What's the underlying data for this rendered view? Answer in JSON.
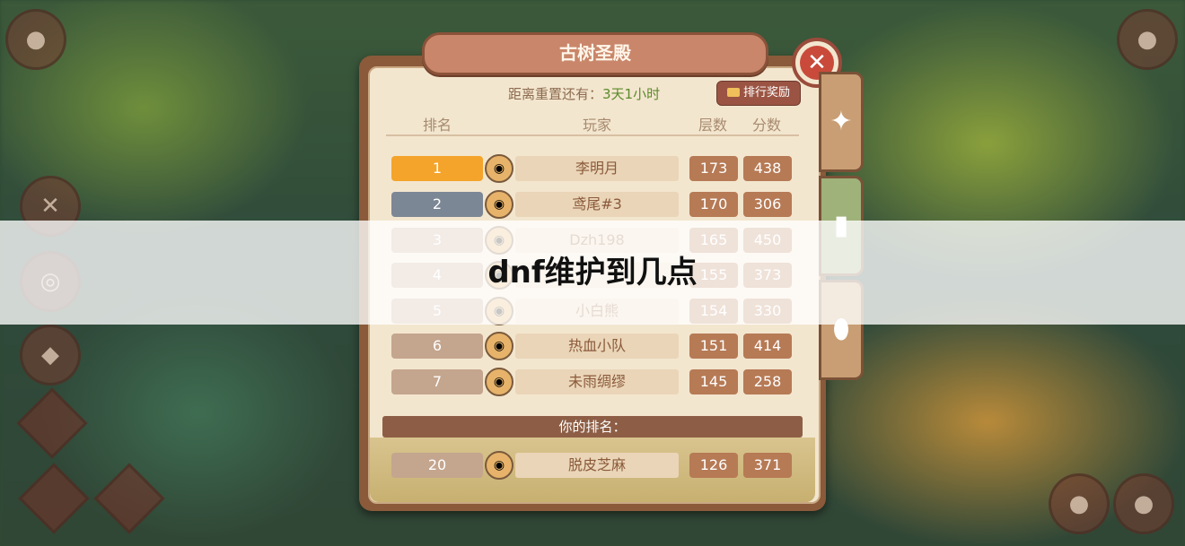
{
  "panel": {
    "title": "古树圣殿",
    "reset_label": "距离重置还有：",
    "reset_value": "3天1小时",
    "reward_button": "排行奖励",
    "headers": {
      "rank": "排名",
      "player": "玩家",
      "floors": "层数",
      "score": "分数"
    },
    "rows": [
      {
        "rank": "1",
        "name": "李明月",
        "floors": "173",
        "score": "438",
        "rank_color": "#f4a42a"
      },
      {
        "rank": "2",
        "name": "鸢尾#3",
        "floors": "170",
        "score": "306",
        "rank_color": "#7c8796"
      },
      {
        "rank": "3",
        "name": "Dzh198",
        "floors": "165",
        "score": "450",
        "rank_color": "#c4a58e"
      },
      {
        "rank": "4",
        "name": "",
        "floors": "155",
        "score": "373",
        "rank_color": "#c4a58e"
      },
      {
        "rank": "5",
        "name": "小白熊",
        "floors": "154",
        "score": "330",
        "rank_color": "#c4a58e"
      },
      {
        "rank": "6",
        "name": "热血小队",
        "floors": "151",
        "score": "414",
        "rank_color": "#c4a58e"
      },
      {
        "rank": "7",
        "name": "未雨绸缪",
        "floors": "145",
        "score": "258",
        "rank_color": "#c4a58e"
      }
    ],
    "your_rank_label": "你的排名：",
    "your_row": {
      "rank": "20",
      "name": "脱皮芝麻",
      "floors": "126",
      "score": "371"
    }
  },
  "overlay": {
    "text": "dnf维护到几点"
  },
  "icons": {
    "close": "close-icon",
    "tab1": "star-cross-icon",
    "tab2": "bars-icon",
    "tab3": "egg-icon",
    "reward": "chest-icon"
  }
}
